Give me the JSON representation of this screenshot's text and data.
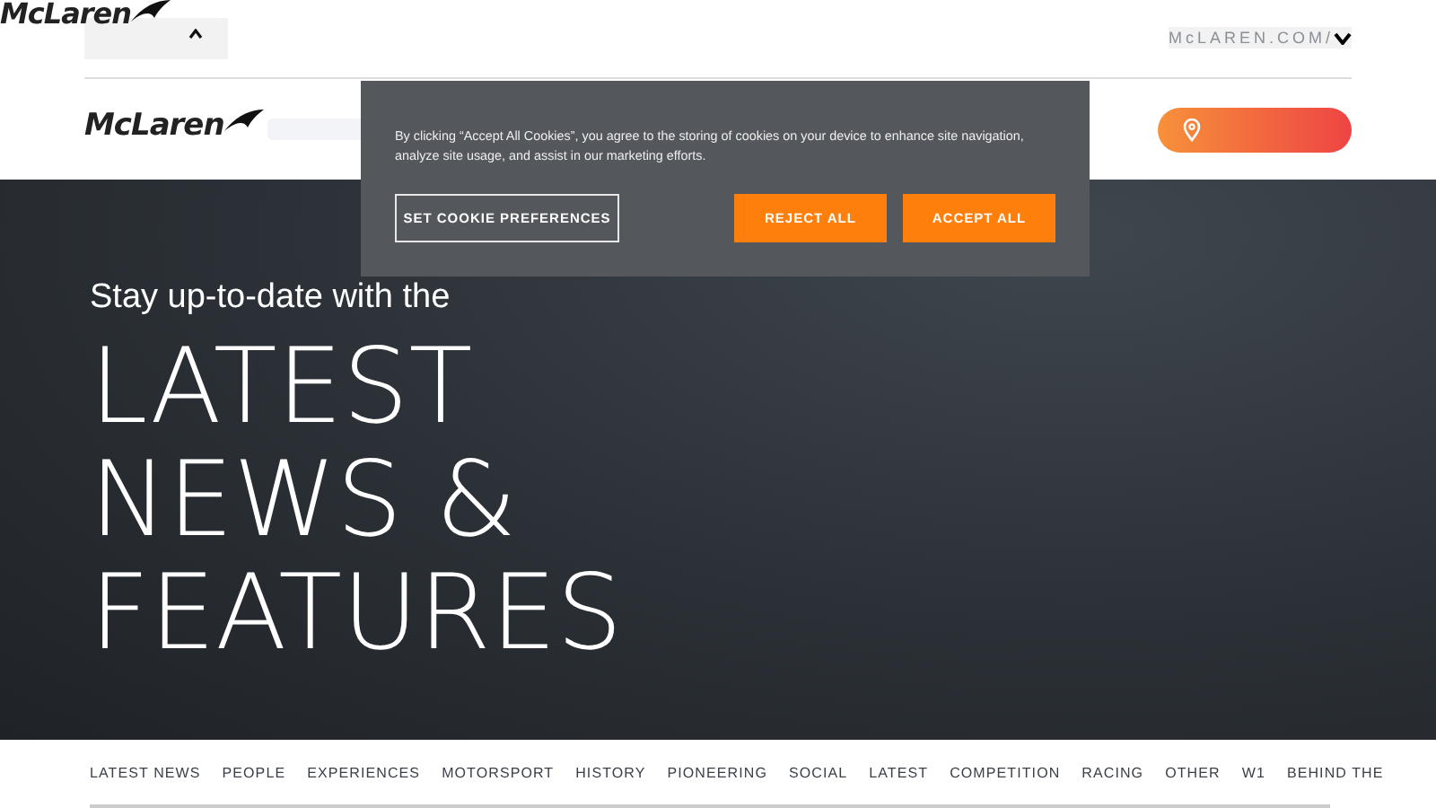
{
  "top_logo": "McLaren",
  "site_switcher": {
    "label": "McLAREN.COM/",
    "expanded": false
  },
  "header": {
    "logo": "McLaren"
  },
  "cookie_banner": {
    "text": "By clicking “Accept All Cookies”, you agree to the storing of cookies on your device to enhance site navigation, analyze site usage, and assist in our marketing efforts.",
    "buttons": [
      {
        "label": "SET COOKIE PREFERENCES",
        "kind": "outline"
      },
      {
        "label": "REJECT ALL",
        "kind": "primary"
      },
      {
        "label": "ACCEPT ALL",
        "kind": "primary"
      }
    ]
  },
  "hero": {
    "kicker": "Stay up-to-date with the",
    "title_lines": [
      "LATEST",
      "NEWS &",
      "FEATURES"
    ]
  },
  "categories": [
    {
      "label": "LATEST NEWS"
    },
    {
      "label": "PEOPLE"
    },
    {
      "label": "EXPERIENCES"
    },
    {
      "label": "MOTORSPORT"
    },
    {
      "label": "HISTORY"
    },
    {
      "label": "PIONEERING"
    },
    {
      "label": "SOCIAL"
    },
    {
      "label": "LATEST"
    },
    {
      "label": "COMPETITION"
    },
    {
      "label": "RACING"
    },
    {
      "label": "OTHER"
    },
    {
      "label": "W1"
    },
    {
      "label": "BEHIND THE"
    }
  ]
}
